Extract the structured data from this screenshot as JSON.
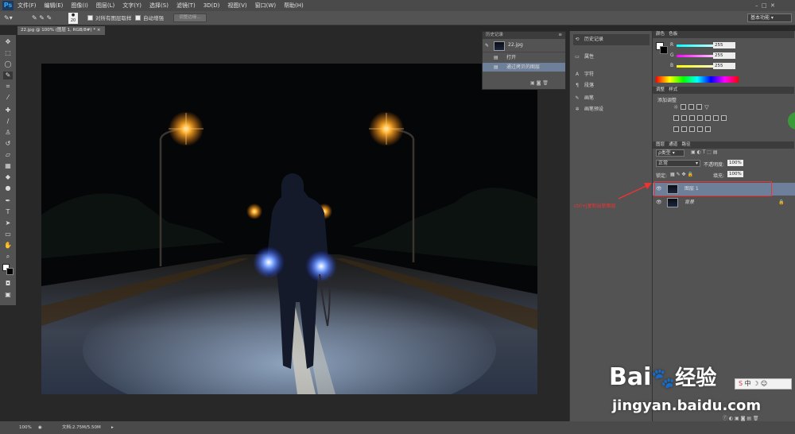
{
  "app": {
    "logo": "Ps"
  },
  "menu": [
    "文件(F)",
    "编辑(E)",
    "图像(I)",
    "图层(L)",
    "文字(Y)",
    "选择(S)",
    "滤镜(T)",
    "3D(D)",
    "视图(V)",
    "窗口(W)",
    "帮助(H)"
  ],
  "options": {
    "size": "20",
    "sample_all_layers": "对所有图层取样",
    "auto_enhance": "自动增强",
    "refine_edge": "调整边缘...",
    "workspace": "基本功能"
  },
  "document": {
    "tab_title": "22.jpg @ 100% (图层 1, RGB/8#) *"
  },
  "history": {
    "title": "历史记录",
    "snapshot": "22.jpg",
    "steps": [
      "打开",
      "通过拷贝的图层"
    ]
  },
  "mid_dock": {
    "items": [
      "历史记录",
      "属性",
      "字符",
      "段落",
      "画笔",
      "画笔预设"
    ]
  },
  "color": {
    "tabs": [
      "颜色",
      "色板"
    ],
    "channels": [
      {
        "label": "R",
        "value": "255"
      },
      {
        "label": "G",
        "value": "255"
      },
      {
        "label": "B",
        "value": "255"
      }
    ]
  },
  "adjustments": {
    "tabs": [
      "调整",
      "样式"
    ],
    "title": "添加调整"
  },
  "layers": {
    "tabs": [
      "图层",
      "通道",
      "路径"
    ],
    "filter": "ρ类型",
    "blend": "正常",
    "opacity_label": "不透明度:",
    "opacity": "100%",
    "lock_label": "锁定:",
    "fill_label": "填充:",
    "fill": "100%",
    "items": [
      "图层 1",
      "背景"
    ]
  },
  "annotation": "ctrl+J复制出新图层",
  "status": {
    "zoom": "100%",
    "doc": "文档:2.75M/5.50M"
  },
  "watermark": {
    "brand": "Bai",
    "brand2": "经验",
    "url": "jingyan.baidu.com",
    "ime": "中"
  }
}
